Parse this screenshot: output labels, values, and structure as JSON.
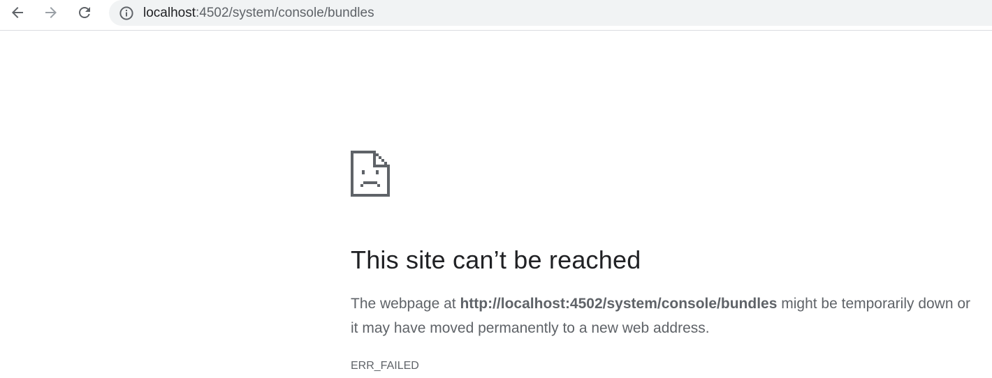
{
  "browser": {
    "back_icon": "arrow-left-icon",
    "forward_icon": "arrow-right-icon",
    "reload_icon": "reload-icon",
    "info_icon": "info-icon",
    "url_host": "localhost",
    "url_rest": ":4502/system/console/bundles"
  },
  "error_page": {
    "icon": "sad-page-icon",
    "title": "This site can’t be reached",
    "desc_prefix": "The webpage at ",
    "desc_url": "http://localhost:4502/system/console/bundles",
    "desc_suffix": " might be temporarily down or it may have moved permanently to a new web address.",
    "error_code": "ERR_FAILED"
  },
  "colors": {
    "text_primary": "#202124",
    "text_secondary": "#5f6368",
    "omnibox_bg": "#f1f3f4",
    "forward_disabled": "#9aa0a6"
  }
}
